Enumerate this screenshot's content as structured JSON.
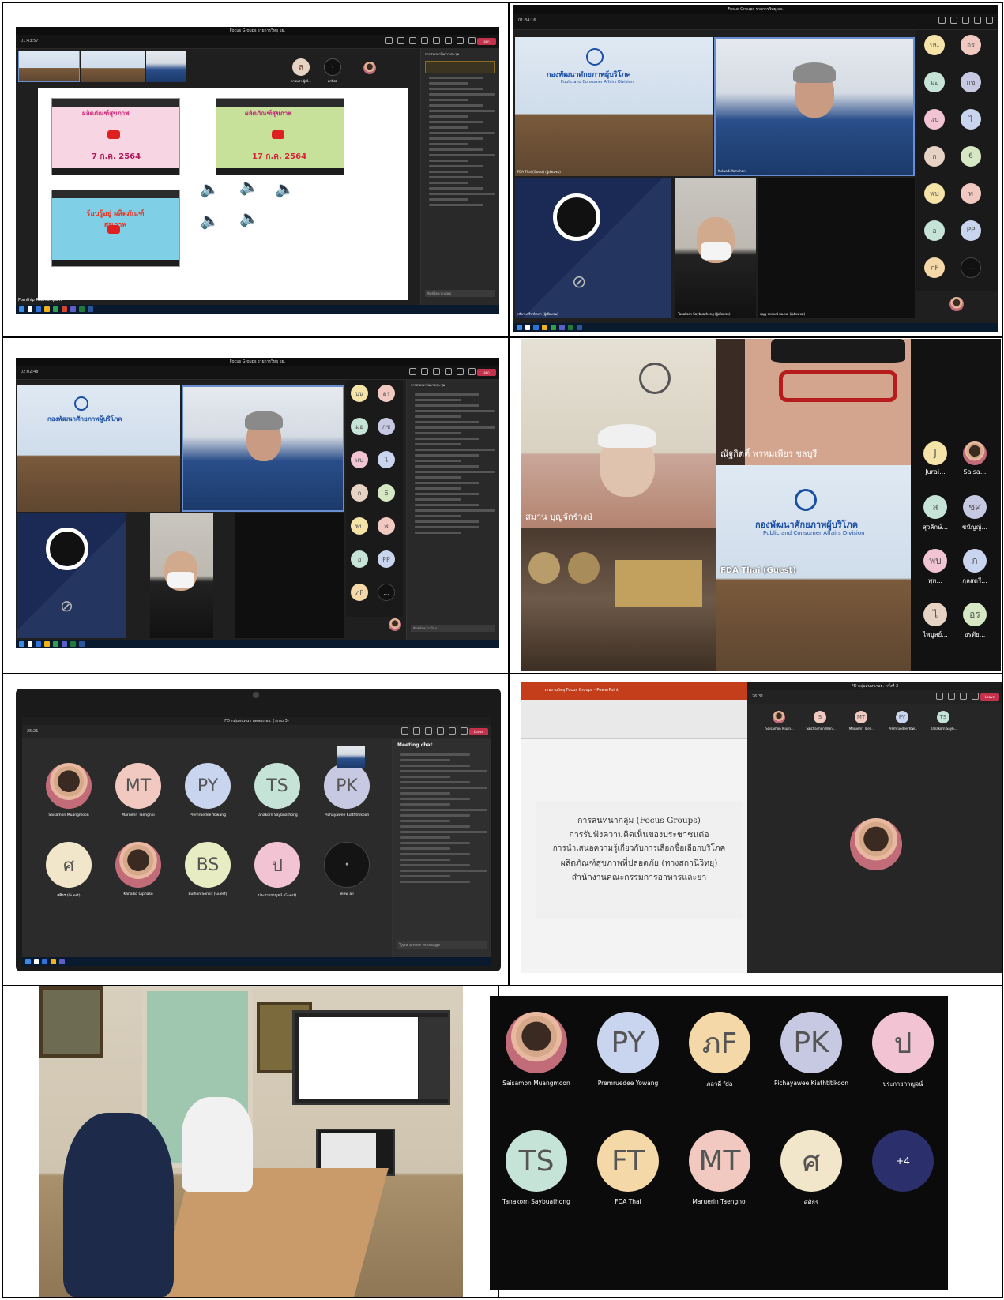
{
  "panel1": {
    "window_title": "Focus Groups รายการวิทยุ อย.",
    "timer": "01:43:57",
    "leave_label": "ออก",
    "chat_header": "การสนทนาในการประชุม",
    "presenter_name": "Pornthip Ruamsinpunt",
    "p1_name": "ดาวนล่า ผู้เข้...",
    "p2_name": "ทุกปิตย์",
    "thumb1_label": "ผลิตภัณฑ์สุขภาพ",
    "thumb1_date": "7 ก.ค. 2564",
    "thumb2_date": "17 ก.ค. 2564",
    "thumb3_label": "ร้อบรู้อยู่ ผลิตภัณฑ์สุขภาพ",
    "chat_placeholder": "พิมพ์ข้อความใหม่"
  },
  "panel2": {
    "window_title": "Focus Groups รายการวิทยุ อย.",
    "timer": "01:34:16",
    "v1_name": "FDA Thai (Guest) (ผู้เยี่ยมชม)",
    "v2_name": "Kulwadi Yamchan",
    "v3_name": "ปรียา เปร็จฑ์เกดา (ผู้เยี่ยมชม)",
    "v4_name": "Tanakorn Saybuathong (ผู้เยี่ยมชม)",
    "v5_name": "บุญรุ จกฤษณ์ ทองพล (ผู้เยี่ยมชม)",
    "banner_th": "กองพัฒนาศักยภาพผู้บริโภค",
    "banner_en": "Public and Consumer Affairs Division",
    "avatars": [
      "บน",
      "อร",
      "มอ",
      "กช",
      "แบ",
      "ไ",
      "ก",
      "6",
      "พบ",
      "พ",
      "อ",
      "PP",
      "ภF",
      "..."
    ]
  },
  "panel3": {
    "window_title": "Focus Groups รายการวิทยุ อย.",
    "timer": "02:02:48",
    "chat_header": "การสนทนาในการประชุม",
    "chat_placeholder": "พิมพ์ข้อความใหม่",
    "avatars": [
      "บน",
      "อร",
      "มอ",
      "กช",
      "แบ",
      "ไ",
      "ก",
      "6",
      "พบ",
      "พ",
      "อ",
      "PP",
      "ภF",
      "..."
    ]
  },
  "panel4": {
    "name1": "ณัฐกิตติ์ พรหมเพียร ชลบุรี",
    "name2": "สมาน บุญจักร์วงษ์",
    "name3": "FDA Thai (Guest)",
    "side": [
      {
        "initial": "J",
        "name": "Jurai..."
      },
      {
        "initial": "",
        "name": "Saisa..."
      },
      {
        "initial": "ส",
        "name": "สุวลักษ์..."
      },
      {
        "initial": "ชศ",
        "name": "ชนัญญ์..."
      },
      {
        "initial": "พบ",
        "name": "พุท..."
      },
      {
        "initial": "ก",
        "name": "กุลสตรี..."
      },
      {
        "initial": "ไ",
        "name": "ไพบูลย์..."
      },
      {
        "initial": "อร",
        "name": "อรทัย..."
      }
    ]
  },
  "panel5": {
    "window_title": "FD กลุ่มสนทนา ทดลอง อย. (ระบบ 3)",
    "timer": "25:21",
    "chat_title": "Meeting chat",
    "chat_placeholder": "Type a new message",
    "participants": [
      {
        "initials": "",
        "name": "Saisamon Muangmoon",
        "photo": true
      },
      {
        "initials": "MT",
        "name": "Maruerin Taengnoi"
      },
      {
        "initials": "PY",
        "name": "Premruedee Yowang"
      },
      {
        "initials": "TS",
        "name": "Tanakorn Saybuathong"
      },
      {
        "initials": "PK",
        "name": "Pichayawee Kiathtitikoon"
      },
      {
        "initials": "ศ",
        "name": "ศศิธร (Guest)"
      },
      {
        "initials": "",
        "name": "Kanaiko Uiphaso",
        "photo": true
      },
      {
        "initials": "BS",
        "name": "Bulhon Sonsit (Guest)"
      },
      {
        "initials": "ป",
        "name": "ประกายกาญจน์ (Guest)"
      },
      {
        "initials": "·",
        "name": "View all"
      }
    ]
  },
  "panel6": {
    "ppt_title": "รายงานวิทยุ Focus Groups - PowerPoint",
    "teams_title": "FD กลุ่มสนทนาอย. ครั้งที่ 2",
    "timer": "26:31",
    "slide_lines": [
      "การสนทนากลุ่ม (Focus Groups)",
      "การรับฟังความคิดเห็นของประชาชนต่อ",
      "การนำเสนอความรู้เกี่ยวกับการเลือกซื้อเลือกบริโภค",
      "ผลิตภัณฑ์สุขภาพที่ปลอดภัย (ทางสถานีวิทยุ)",
      "สำนักงานคณะกรรมการอาหารและยา"
    ],
    "strip": [
      {
        "initials": "",
        "name": "Saisamon Muan..."
      },
      {
        "initials": "S",
        "name": "Saichaimon Wan..."
      },
      {
        "initials": "MT",
        "name": "Maruerin Taen..."
      },
      {
        "initials": "PY",
        "name": "Premruedee Yow..."
      },
      {
        "initials": "TS",
        "name": "Tanakorn Sayb..."
      }
    ]
  },
  "panel8": {
    "participants": [
      {
        "initials": "",
        "name": "Saisamon Muangmoon",
        "photo": true
      },
      {
        "initials": "PY",
        "name": "Premruedee Yowang"
      },
      {
        "initials": "ภF",
        "name": "ภลวดี fda"
      },
      {
        "initials": "PK",
        "name": "Pichayawee Kiathtitikoon"
      },
      {
        "initials": "ป",
        "name": "ประกายกาญจน์"
      },
      {
        "initials": "TS",
        "name": "Tanakorn Saybuathong"
      },
      {
        "initials": "FT",
        "name": "FDA Thai"
      },
      {
        "initials": "MT",
        "name": "Maruerin Taengnoi"
      },
      {
        "initials": "ศ",
        "name": "ศศิธร"
      },
      {
        "initials": "+4",
        "name": ""
      }
    ]
  },
  "colors": {
    "teams_bg": "#1f1f1f",
    "leave_red": "#c4314b",
    "av_py": "#c9d4ee",
    "av_mt": "#f1c9c0",
    "av_ts": "#c6e3d8",
    "av_pk": "#c7c9e3",
    "av_tf": "#f5d8a8",
    "av_p": "#f1c3d3"
  }
}
